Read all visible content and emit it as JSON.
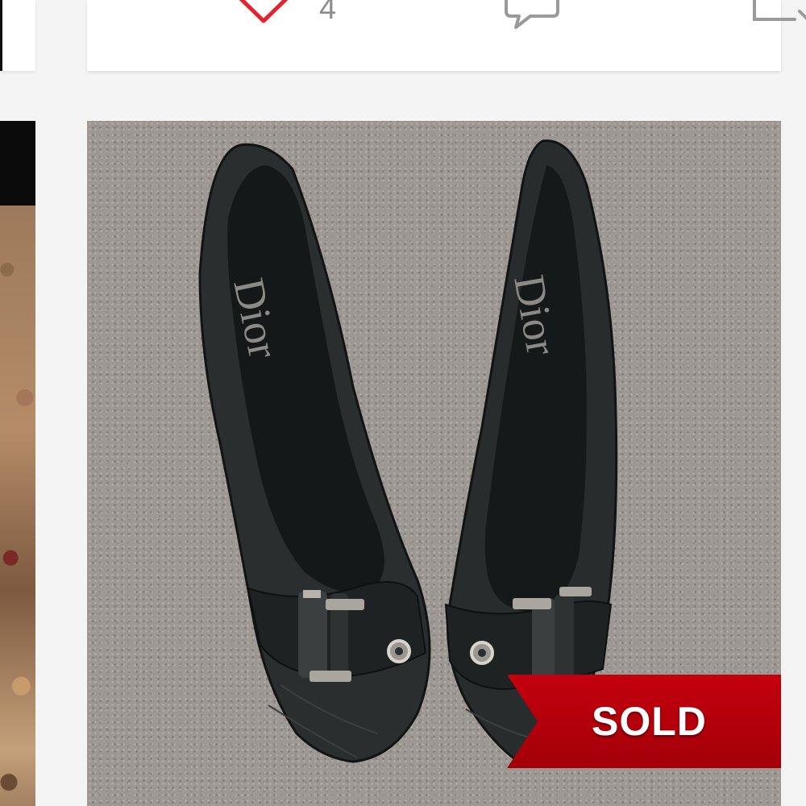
{
  "actions": {
    "like_count": "4",
    "like_icon": "heart-icon",
    "comment_icon": "comment-icon",
    "share_icon": "share-icon",
    "like_color": "#e5232f"
  },
  "listing": {
    "photo_subject": "pair of black pointed-toe Dior pumps with buckle straps on carpet",
    "insole_brand_left": "Dior",
    "insole_brand_right": "Dior",
    "status_badge": "SOLD",
    "badge_color": "#b3000c"
  }
}
